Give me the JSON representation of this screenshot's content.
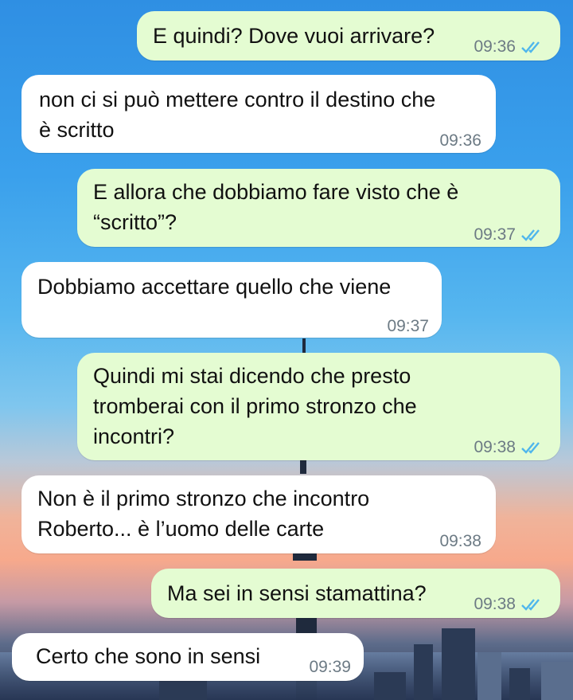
{
  "chat": {
    "messages": [
      {
        "direction": "out",
        "text": "E quindi? Dove vuoi arrivare?",
        "time": "09:36",
        "status": "read"
      },
      {
        "direction": "in",
        "text": "non ci si può mettere contro il destino che\nè scritto",
        "time": "09:36"
      },
      {
        "direction": "out",
        "text": "E allora che dobbiamo fare visto che è\n“scritto”?",
        "time": "09:37",
        "status": "read"
      },
      {
        "direction": "in",
        "text": "Dobbiamo accettare quello che viene",
        "time": "09:37"
      },
      {
        "direction": "out",
        "text": "Quindi mi stai dicendo che presto\ntromberai con il primo stronzo che\nincontri?",
        "time": "09:38",
        "status": "read"
      },
      {
        "direction": "in",
        "text": "Non è il primo stronzo che incontro\nRoberto... è l’uomo delle carte",
        "time": "09:38"
      },
      {
        "direction": "out",
        "text": "Ma sei in sensi stamattina?",
        "time": "09:38",
        "status": "read"
      },
      {
        "direction": "in",
        "text": "Certo che sono in sensi",
        "time": "09:39"
      }
    ]
  },
  "colors": {
    "outgoing_bubble": "#e4fcd2",
    "incoming_bubble": "#ffffff",
    "read_tick": "#4fb6ec",
    "meta_text": "#6c7a84"
  },
  "icons": {
    "read_receipt": "double-check-icon"
  }
}
